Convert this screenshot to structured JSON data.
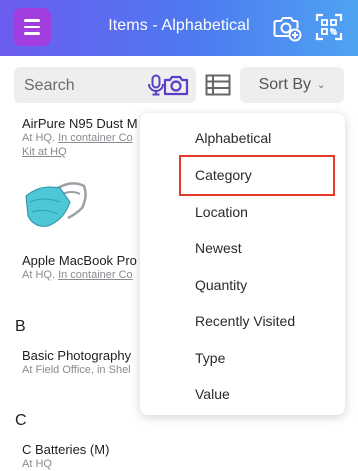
{
  "header": {
    "title": "Items - Alphabetical"
  },
  "search": {
    "placeholder": "Search",
    "sort_label": "Sort By"
  },
  "list": {
    "items": [
      {
        "name": "AirPure N95 Dust M",
        "sub1_pre": "At HQ. ",
        "sub1_link": "In container Co",
        "sub2_link": "Kit at HQ"
      },
      {
        "name": "Apple MacBook Pro",
        "sub1_pre": "At HQ. ",
        "sub1_link": "In container Co"
      },
      {
        "name": "Basic Photography",
        "sub": "At Field Office, in Shel"
      },
      {
        "name": "C Batteries (M)",
        "sub": "At HQ"
      }
    ],
    "letters": [
      "B",
      "C"
    ]
  },
  "sort_menu": {
    "options": [
      "Alphabetical",
      "Category",
      "Location",
      "Newest",
      "Quantity",
      "Recently Visited",
      "Type",
      "Value"
    ],
    "highlighted": "Category"
  },
  "colors": {
    "header_gradient_start": "#6c5cf0",
    "header_gradient_end": "#4fa3f2",
    "menu_button": "#a23de0",
    "accent_purple": "#5b3ec8",
    "highlight_border": "#e53a2b"
  },
  "icons": {
    "menu": "hamburger-icon",
    "add_photo": "camera-plus-icon",
    "scan": "qr-scan-icon",
    "mic": "microphone-icon",
    "camera": "camera-icon",
    "view": "list-view-icon",
    "sort_chevron": "chevron-down-icon"
  }
}
